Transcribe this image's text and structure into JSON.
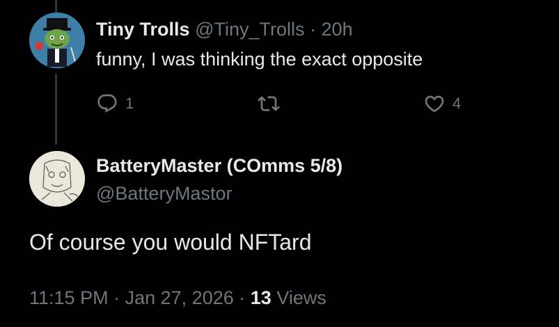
{
  "reply": {
    "display_name": "Tiny Trolls",
    "handle": "@Tiny_Trolls",
    "separator": "·",
    "time": "20h",
    "text": "funny, I was thinking the exact opposite",
    "actions": {
      "reply_count": "1",
      "retweet_count": "",
      "like_count": "4"
    }
  },
  "main": {
    "display_name": "BatteryMaster (COmms 5/8)",
    "handle": "@BatteryMastor",
    "text": "Of course you would NFTard",
    "time": "11:15 PM",
    "separator": "·",
    "date": "Jan 27, 2026",
    "views_count": "13",
    "views_label": "Views"
  },
  "colors": {
    "background": "#000000",
    "primary_text": "#e7e9ea",
    "secondary_text": "#71767b",
    "thread_line": "#333639"
  }
}
